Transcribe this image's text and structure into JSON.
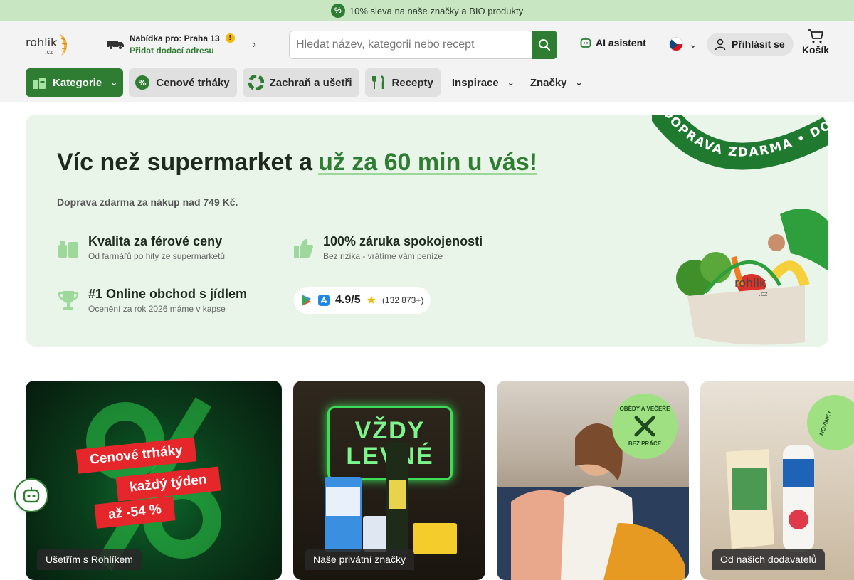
{
  "promo": {
    "text": "10% sleva na naše značky a BIO produkty"
  },
  "header": {
    "logo": {
      "text": "rohlik",
      "suffix": ".cz"
    },
    "delivery": {
      "line1": "Nabídka pro: Praha 13",
      "line2": "Přidat dodací adresu"
    },
    "search": {
      "placeholder": "Hledat název, kategorii nebo recept"
    },
    "ai_label": "AI asistent",
    "login_label": "Přihlásit se",
    "cart_label": "Košík"
  },
  "nav": {
    "items": [
      {
        "label": "Kategorie"
      },
      {
        "label": "Cenové trháky"
      },
      {
        "label": "Zachraň a ušetři"
      },
      {
        "label": "Recepty"
      },
      {
        "label": "Inspirace"
      },
      {
        "label": "Značky"
      }
    ]
  },
  "hero": {
    "title": "Víc než supermarket a",
    "title_accent": "už za 60 min u vás!",
    "subtitle": "Doprava zdarma za nákup nad 749 Kč.",
    "features": [
      {
        "title": "Kvalita za férové ceny",
        "subtitle": "Od farmářů po hity ze supermarketů"
      },
      {
        "title": "100% záruka spokojenosti",
        "subtitle": "Bez rizika - vrátíme vám peníze"
      },
      {
        "title": "#1 Online obchod s jídlem",
        "subtitle": "Ocenění za rok 2026 máme v kapse"
      }
    ],
    "rating": {
      "score": "4.9/5",
      "count": "(132 873+)"
    },
    "ribbon_text": "DOPRAVA ZDARMA • DO",
    "bag_logo": "rohlik",
    "bag_logo_suffix": ".cz"
  },
  "cards": [
    {
      "caption": "Ušetřím s Rohlíkem",
      "tags": [
        "Cenové trháky",
        "každý týden",
        "až -54 %"
      ]
    },
    {
      "caption": "Naše privátní značky",
      "neon": [
        "VŽDY",
        "LEVNÉ"
      ]
    },
    {
      "caption": "",
      "badge_top": "OBĚDY A VEČEŘE",
      "badge_bottom": "BEZ PRÁCE"
    },
    {
      "caption": "Od našich dodavatelů",
      "badge_top": "NOVINKY"
    }
  ],
  "colors": {
    "brand": "#2e7d32",
    "promo_bg": "#c8e6c2",
    "hero_bg": "#eaf5ea",
    "tag_red": "#e5262a"
  }
}
